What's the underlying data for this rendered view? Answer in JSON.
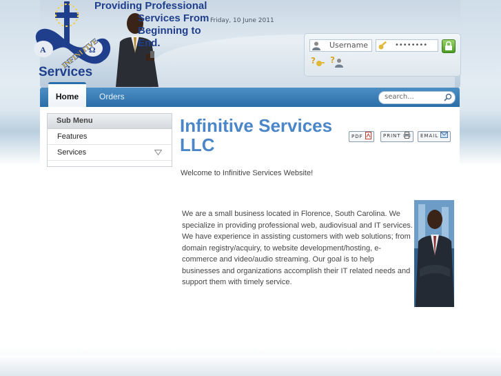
{
  "header": {
    "logo_word": "INFINITIVE",
    "logo_symbols": [
      "A",
      "Ω"
    ],
    "logo_services": "Services",
    "tagline": [
      "Providing Professional",
      "Services From",
      "Beginning to",
      "End."
    ],
    "date": "Friday, 10 June 2011"
  },
  "login": {
    "username_placeholder": "Username",
    "password_value": "••••••••",
    "icons": [
      "user-icon",
      "key-icon",
      "login-lock-icon",
      "forgot-password-icon",
      "forgot-username-icon"
    ],
    "login_color": "#5aa62c"
  },
  "nav": {
    "tabs": [
      {
        "label": "Home",
        "active": true
      },
      {
        "label": "Orders",
        "active": false
      }
    ],
    "search_placeholder": "search...",
    "accent": "#2a6ea8"
  },
  "submenu": {
    "title": "Sub Menu",
    "items": [
      {
        "label": "Features"
      },
      {
        "label": "Services"
      }
    ]
  },
  "article": {
    "title": "Infinitive Services LLC",
    "buttons": {
      "pdf": "PDF",
      "print": "PRINT",
      "email": "EMAIL"
    },
    "welcome": "Welcome to Infinitive Services Website!",
    "body": " We are a small business located in Florence, South Carolina.  We specialize in providing professional web, audiovisual and IT services.  We have experience in assisting customers with web solutions; from domain registry/acquiry, to website development/hosting, e-commerce and video/audio streaming.  Our goal is to help businesses and organizations accomplish their IT related needs and support them with timely service.",
    "title_color": "#4a86c8"
  }
}
